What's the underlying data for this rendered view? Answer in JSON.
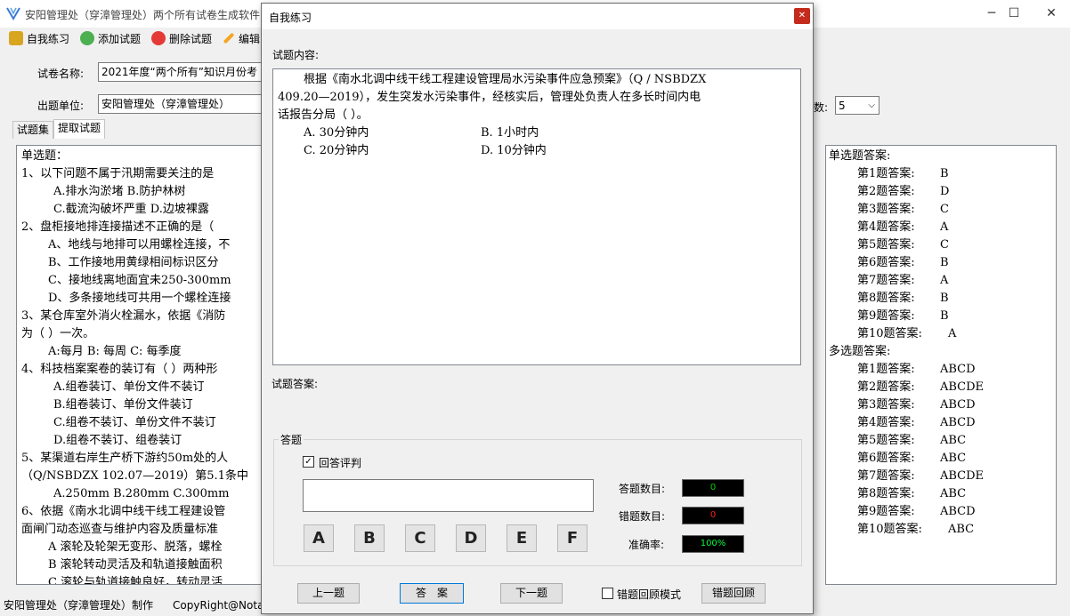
{
  "window": {
    "title": "安阳管理处（穿漳管理处）两个所有试卷生成软件"
  },
  "toolbar": [
    {
      "label": "自我练习",
      "icon": "practice-icon"
    },
    {
      "label": "添加试题",
      "icon": "add-icon"
    },
    {
      "label": "删除试题",
      "icon": "delete-icon"
    },
    {
      "label": "编辑",
      "icon": "edit-icon"
    }
  ],
  "form": {
    "paper_name_label": "试卷名称:",
    "paper_name_value": "2021年度“两个所有”知识月份考",
    "unit_label": "出题单位:",
    "unit_value": "安阳管理处（穿漳管理处）",
    "count_label": "数:",
    "count_value": "5"
  },
  "tabs": [
    "试题集",
    "提取试题"
  ],
  "left_pane": {
    "lines": [
      {
        "text": "单选题：",
        "indent": 0
      },
      {
        "text": "1、以下问题不属于汛期需要关注的是",
        "indent": 0
      },
      {
        "text": "A.排水沟淤堵            B.防护林树",
        "indent": 2
      },
      {
        "text": "C.截流沟破坏严重        D.边坡裸露",
        "indent": 2
      },
      {
        "text": "2、盘柜接地排连接描述不正确的是（",
        "indent": 0
      },
      {
        "text": "A、地线与地排可以用螺栓连接，不",
        "indent": 1
      },
      {
        "text": "B、工作接地用黄绿相间标识区分",
        "indent": 1
      },
      {
        "text": "C、接地线离地面宜未250-300mm",
        "indent": 1
      },
      {
        "text": "D、多条接地线可共用一个螺栓连接",
        "indent": 1
      },
      {
        "text": "3、某仓库室外消火栓漏水，依据《消防",
        "indent": 0
      },
      {
        "text": "为（    ）一次。",
        "indent": 0
      },
      {
        "text": "A:每月      B: 每周     C: 每季度",
        "indent": 1
      },
      {
        "text": "4、科技档案案卷的装订有（  ）两种形",
        "indent": 0
      },
      {
        "text": "A.组卷装订、单份文件不装订",
        "indent": 2
      },
      {
        "text": "B.组卷装订、单份文件装订",
        "indent": 2
      },
      {
        "text": "C.组卷不装订、单份文件不装订",
        "indent": 2
      },
      {
        "text": "D.组卷不装订、组卷装订",
        "indent": 2
      },
      {
        "text": "5、某渠道右岸生产桥下游约50m处的人",
        "indent": 0
      },
      {
        "text": "（Q/NSBDZX 102.07—2019）第5.1条中",
        "indent": 0
      },
      {
        "text": "A.250mm     B.280mm     C.300mm",
        "indent": 2
      },
      {
        "text": "6、依据《南水北调中线干线工程建设管",
        "indent": 0
      },
      {
        "text": "面闸门动态巡查与维护内容及质量标准",
        "indent": 0
      },
      {
        "text": "A 滚轮及轮架无变形、脱落，螺栓",
        "indent": 1
      },
      {
        "text": "B 滚轮转动灵活及和轨道接触面积",
        "indent": 1
      },
      {
        "text": "C 滚轮与轨道接触良好，转动灵活",
        "indent": 1
      }
    ]
  },
  "right_pane": {
    "single_header": "单选题答案:",
    "single": [
      {
        "label": "第1题答案:",
        "answer": "B"
      },
      {
        "label": "第2题答案:",
        "answer": "D"
      },
      {
        "label": "第3题答案:",
        "answer": "C"
      },
      {
        "label": "第4题答案:",
        "answer": "A"
      },
      {
        "label": "第5题答案:",
        "answer": "C"
      },
      {
        "label": "第6题答案:",
        "answer": "B"
      },
      {
        "label": "第7题答案:",
        "answer": "A"
      },
      {
        "label": "第8题答案:",
        "answer": "B"
      },
      {
        "label": "第9题答案:",
        "answer": "B"
      },
      {
        "label": "第10题答案:",
        "answer": "A"
      }
    ],
    "multi_header": "多选题答案:",
    "multi": [
      {
        "label": "第1题答案:",
        "answer": "ABCD"
      },
      {
        "label": "第2题答案:",
        "answer": "ABCDE"
      },
      {
        "label": "第3题答案:",
        "answer": "ABCD"
      },
      {
        "label": "第4题答案:",
        "answer": "ABCD"
      },
      {
        "label": "第5题答案:",
        "answer": "ABC"
      },
      {
        "label": "第6题答案:",
        "answer": "ABC"
      },
      {
        "label": "第7题答案:",
        "answer": "ABCDE"
      },
      {
        "label": "第8题答案:",
        "answer": "ABC"
      },
      {
        "label": "第9题答案:",
        "answer": "ABCD"
      },
      {
        "label": "第10题答案:",
        "answer": "ABC"
      }
    ]
  },
  "status_bar": {
    "unit": "安阳管理处（穿漳管理处）制作",
    "copyright": "CopyRight@Nota"
  },
  "dialog": {
    "title": "自我练习",
    "content_label": "试题内容:",
    "question_lines": [
      "根据《南水北调中线干线工程建设管理局水污染事件应急预案》（Q / NSBDZX",
      "409.20—2019），发生突发水污染事件，经核实后，管理处负责人在多长时间内电",
      "话报告分局（    ）。"
    ],
    "options": [
      {
        "text": "A.  30分钟内"
      },
      {
        "text": "B.  1小时内"
      },
      {
        "text": "C.  20分钟内"
      },
      {
        "text": "D.  10分钟内"
      }
    ],
    "answer_label": "试题答案:",
    "group_label": "答题",
    "grade_checkbox_label": "回答评判",
    "grade_checked": true,
    "answer_input_value": "",
    "answer_buttons": [
      "A",
      "B",
      "C",
      "D",
      "E",
      "F"
    ],
    "answered_label": "答题数目:",
    "answered_value": "0",
    "wrong_label": "错题数目:",
    "wrong_value": "0",
    "accuracy_label": "准确率:",
    "accuracy_value": "100%",
    "prev_button": "上一题",
    "answer_button": "答　案",
    "next_button": "下一题",
    "review_mode_label": "错题回顾模式",
    "review_mode_checked": false,
    "review_button": "错题回顾"
  },
  "colors": {
    "counter_answered": "#00d000",
    "counter_wrong": "#ff2020",
    "counter_accuracy": "#00ff40",
    "close_button": "#c42b1c"
  }
}
